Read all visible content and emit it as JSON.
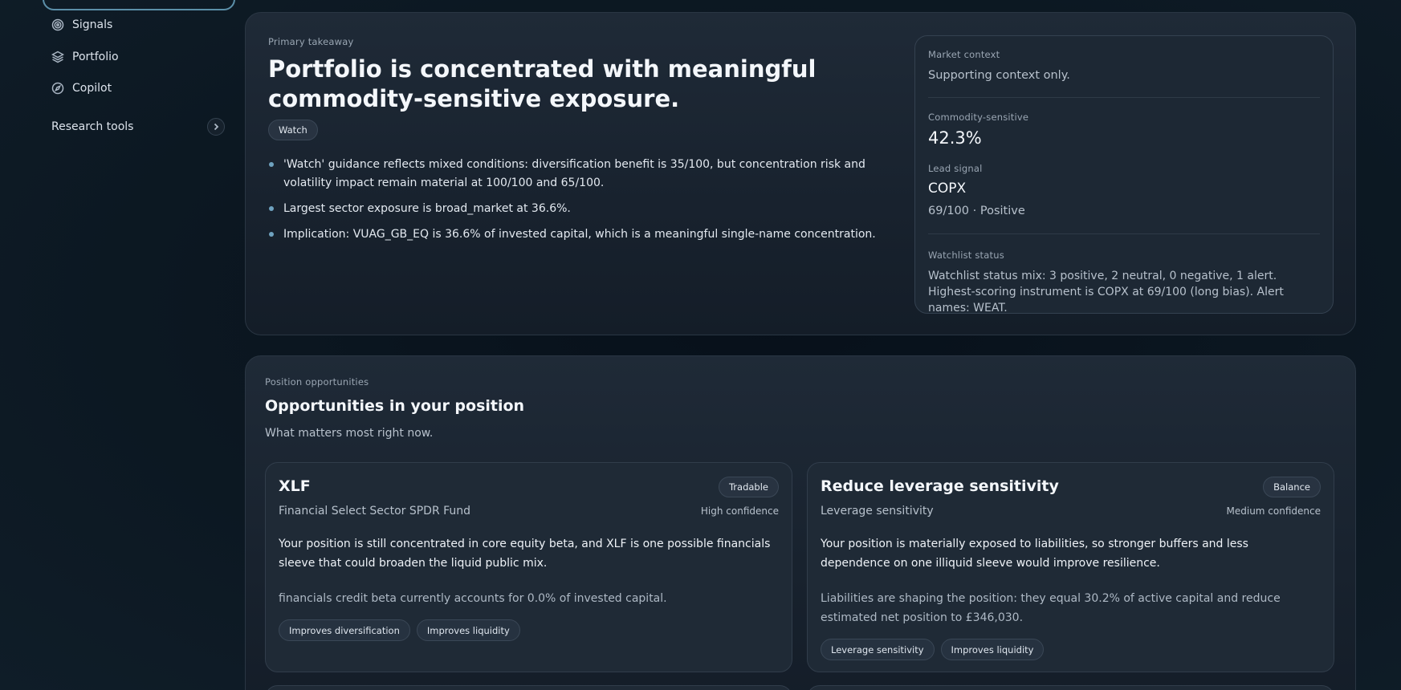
{
  "sidebar": {
    "items": [
      {
        "label": "Signals",
        "icon": "signals-icon"
      },
      {
        "label": "Portfolio",
        "icon": "layers-icon"
      },
      {
        "label": "Copilot",
        "icon": "compass-icon"
      }
    ],
    "research_tools": "Research tools"
  },
  "takeaway": {
    "eyebrow": "Primary takeaway",
    "title": "Portfolio is concentrated with meaningful commodity-sensitive exposure.",
    "badge": "Watch",
    "bullets": [
      "'Watch' guidance reflects mixed conditions: diversification benefit is 35/100, but concentration risk and volatility impact remain material at 100/100 and 65/100.",
      "Largest sector exposure is broad_market at 36.6%.",
      "Implication: VUAG_GB_EQ is 36.6% of invested capital, which is a meaningful single-name concentration."
    ],
    "context": {
      "label": "Market context",
      "subtitle": "Supporting context only.",
      "commodity_label": "Commodity-sensitive",
      "commodity_value": "42.3%",
      "lead_label": "Lead signal",
      "lead_value": "COPX",
      "lead_detail": "69/100 · Positive",
      "watchlist_label": "Watchlist status",
      "watchlist_text": "Watchlist status mix: 3 positive, 2 neutral, 0 negative, 1 alert. Highest-scoring instrument is COPX at 69/100 (long bias). Alert names: WEAT."
    }
  },
  "opportunities": {
    "eyebrow": "Position opportunities",
    "title": "Opportunities in your position",
    "subtitle": "What matters most right now.",
    "cards": [
      {
        "name": "XLF",
        "badge": "Tradable",
        "desc": "Financial Select Sector SPDR Fund",
        "confidence": "High confidence",
        "body": "Your position is still concentrated in core equity beta, and XLF is one possible financials sleeve that could broaden the liquid public mix.",
        "note": "financials credit beta currently accounts for 0.0% of invested capital.",
        "tags": [
          "Improves diversification",
          "Improves liquidity"
        ]
      },
      {
        "name": "Reduce leverage sensitivity",
        "badge": "Balance",
        "desc": "Leverage sensitivity",
        "confidence": "Medium confidence",
        "body": "Your position is materially exposed to liabilities, so stronger buffers and less dependence on one illiquid sleeve would improve resilience.",
        "note": "Liabilities are shaping the position: they equal 30.2% of active capital and reduce estimated net position to £346,030.",
        "tags": [
          "Leverage sensitivity",
          "Improves liquidity"
        ]
      }
    ]
  }
}
